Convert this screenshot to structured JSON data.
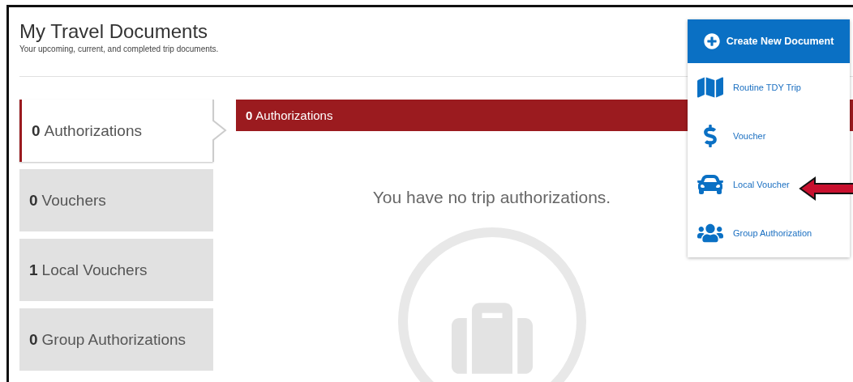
{
  "header": {
    "title": "My Travel Documents",
    "subtitle": "Your upcoming, current, and completed trip documents."
  },
  "tabs": [
    {
      "count": "0",
      "label": "Authorizations",
      "selected": true
    },
    {
      "count": "0",
      "label": "Vouchers",
      "selected": false
    },
    {
      "count": "1",
      "label": "Local Vouchers",
      "selected": false
    },
    {
      "count": "0",
      "label": "Group Authorizations",
      "selected": false
    }
  ],
  "panel": {
    "count": "0",
    "label": "Authorizations",
    "empty_message": "You have no trip authorizations."
  },
  "create_menu": {
    "button": "Create New Document",
    "expanded": true,
    "items": [
      {
        "kind": "map",
        "label": "Routine TDY Trip"
      },
      {
        "kind": "dollar",
        "label": "Voucher"
      },
      {
        "kind": "car",
        "label": "Local Voucher",
        "pointed": true
      },
      {
        "kind": "group",
        "label": "Group Authorization"
      }
    ]
  }
}
